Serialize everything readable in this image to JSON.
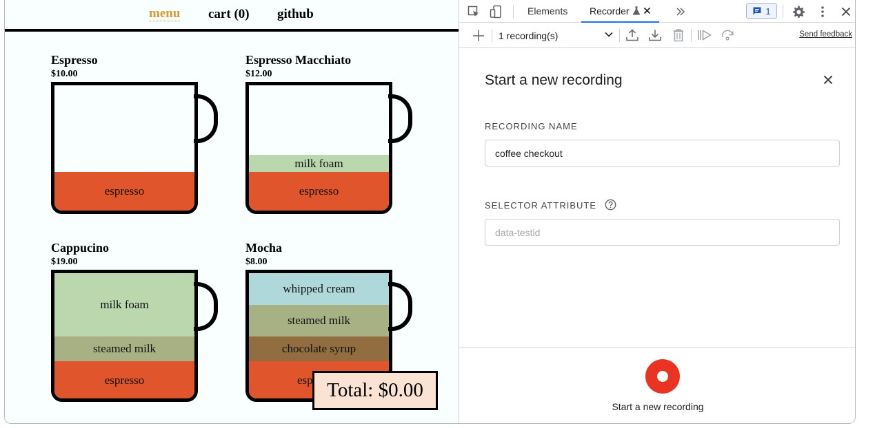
{
  "site": {
    "nav": {
      "menu": "menu",
      "cart": "cart (0)",
      "github": "github"
    },
    "coffees": [
      {
        "name": "Espresso",
        "price": "$10.00",
        "layers": [
          {
            "label": "espresso",
            "kind": "espresso"
          }
        ]
      },
      {
        "name": "Espresso Macchiato",
        "price": "$12.00",
        "layers": [
          {
            "label": "milk foam",
            "kind": "foam"
          },
          {
            "label": "espresso",
            "kind": "espresso"
          }
        ]
      },
      {
        "name": "Cappucino",
        "price": "$19.00",
        "layers": [
          {
            "label": "milk foam",
            "kind": "foam"
          },
          {
            "label": "steamed milk",
            "kind": "steamed"
          },
          {
            "label": "espresso",
            "kind": "espresso"
          }
        ]
      },
      {
        "name": "Mocha",
        "price": "$8.00",
        "layers": [
          {
            "label": "whipped cream",
            "kind": "whipped"
          },
          {
            "label": "steamed milk",
            "kind": "steamed"
          },
          {
            "label": "chocolate syrup",
            "kind": "choc"
          },
          {
            "label": "espresso",
            "kind": "espresso"
          }
        ]
      }
    ],
    "total": "Total: $0.00",
    "colors": {
      "accent": "#d9992e",
      "espresso": "#e0552c",
      "milk_foam": "#bad7ae",
      "steamed_milk": "#a7b184",
      "chocolate_syrup": "#916d3f",
      "whipped_cream": "#aed8d9",
      "total_bg": "#fbe3d3"
    }
  },
  "devtools": {
    "tabs": {
      "elements": "Elements",
      "recorder": "Recorder"
    },
    "icons": {
      "inspect": "inspect-element-icon",
      "device": "device-toolbar-icon",
      "beaker": "experiment-icon",
      "more_tabs": "more-tabs-icon",
      "settings": "gear-icon",
      "menu": "kebab-menu-icon",
      "close": "close-icon"
    },
    "issues_count": "1",
    "toolbar": {
      "recordings": "1 recording(s)",
      "feedback": "Send feedback"
    },
    "panel": {
      "title": "Start a new recording",
      "name_label": "RECORDING NAME",
      "name_value": "coffee checkout",
      "selector_label": "SELECTOR ATTRIBUTE",
      "selector_placeholder": "data-testid"
    },
    "start_label": "Start a new recording",
    "colors": {
      "accent": "#1a73e8",
      "record": "#ea3323"
    }
  }
}
